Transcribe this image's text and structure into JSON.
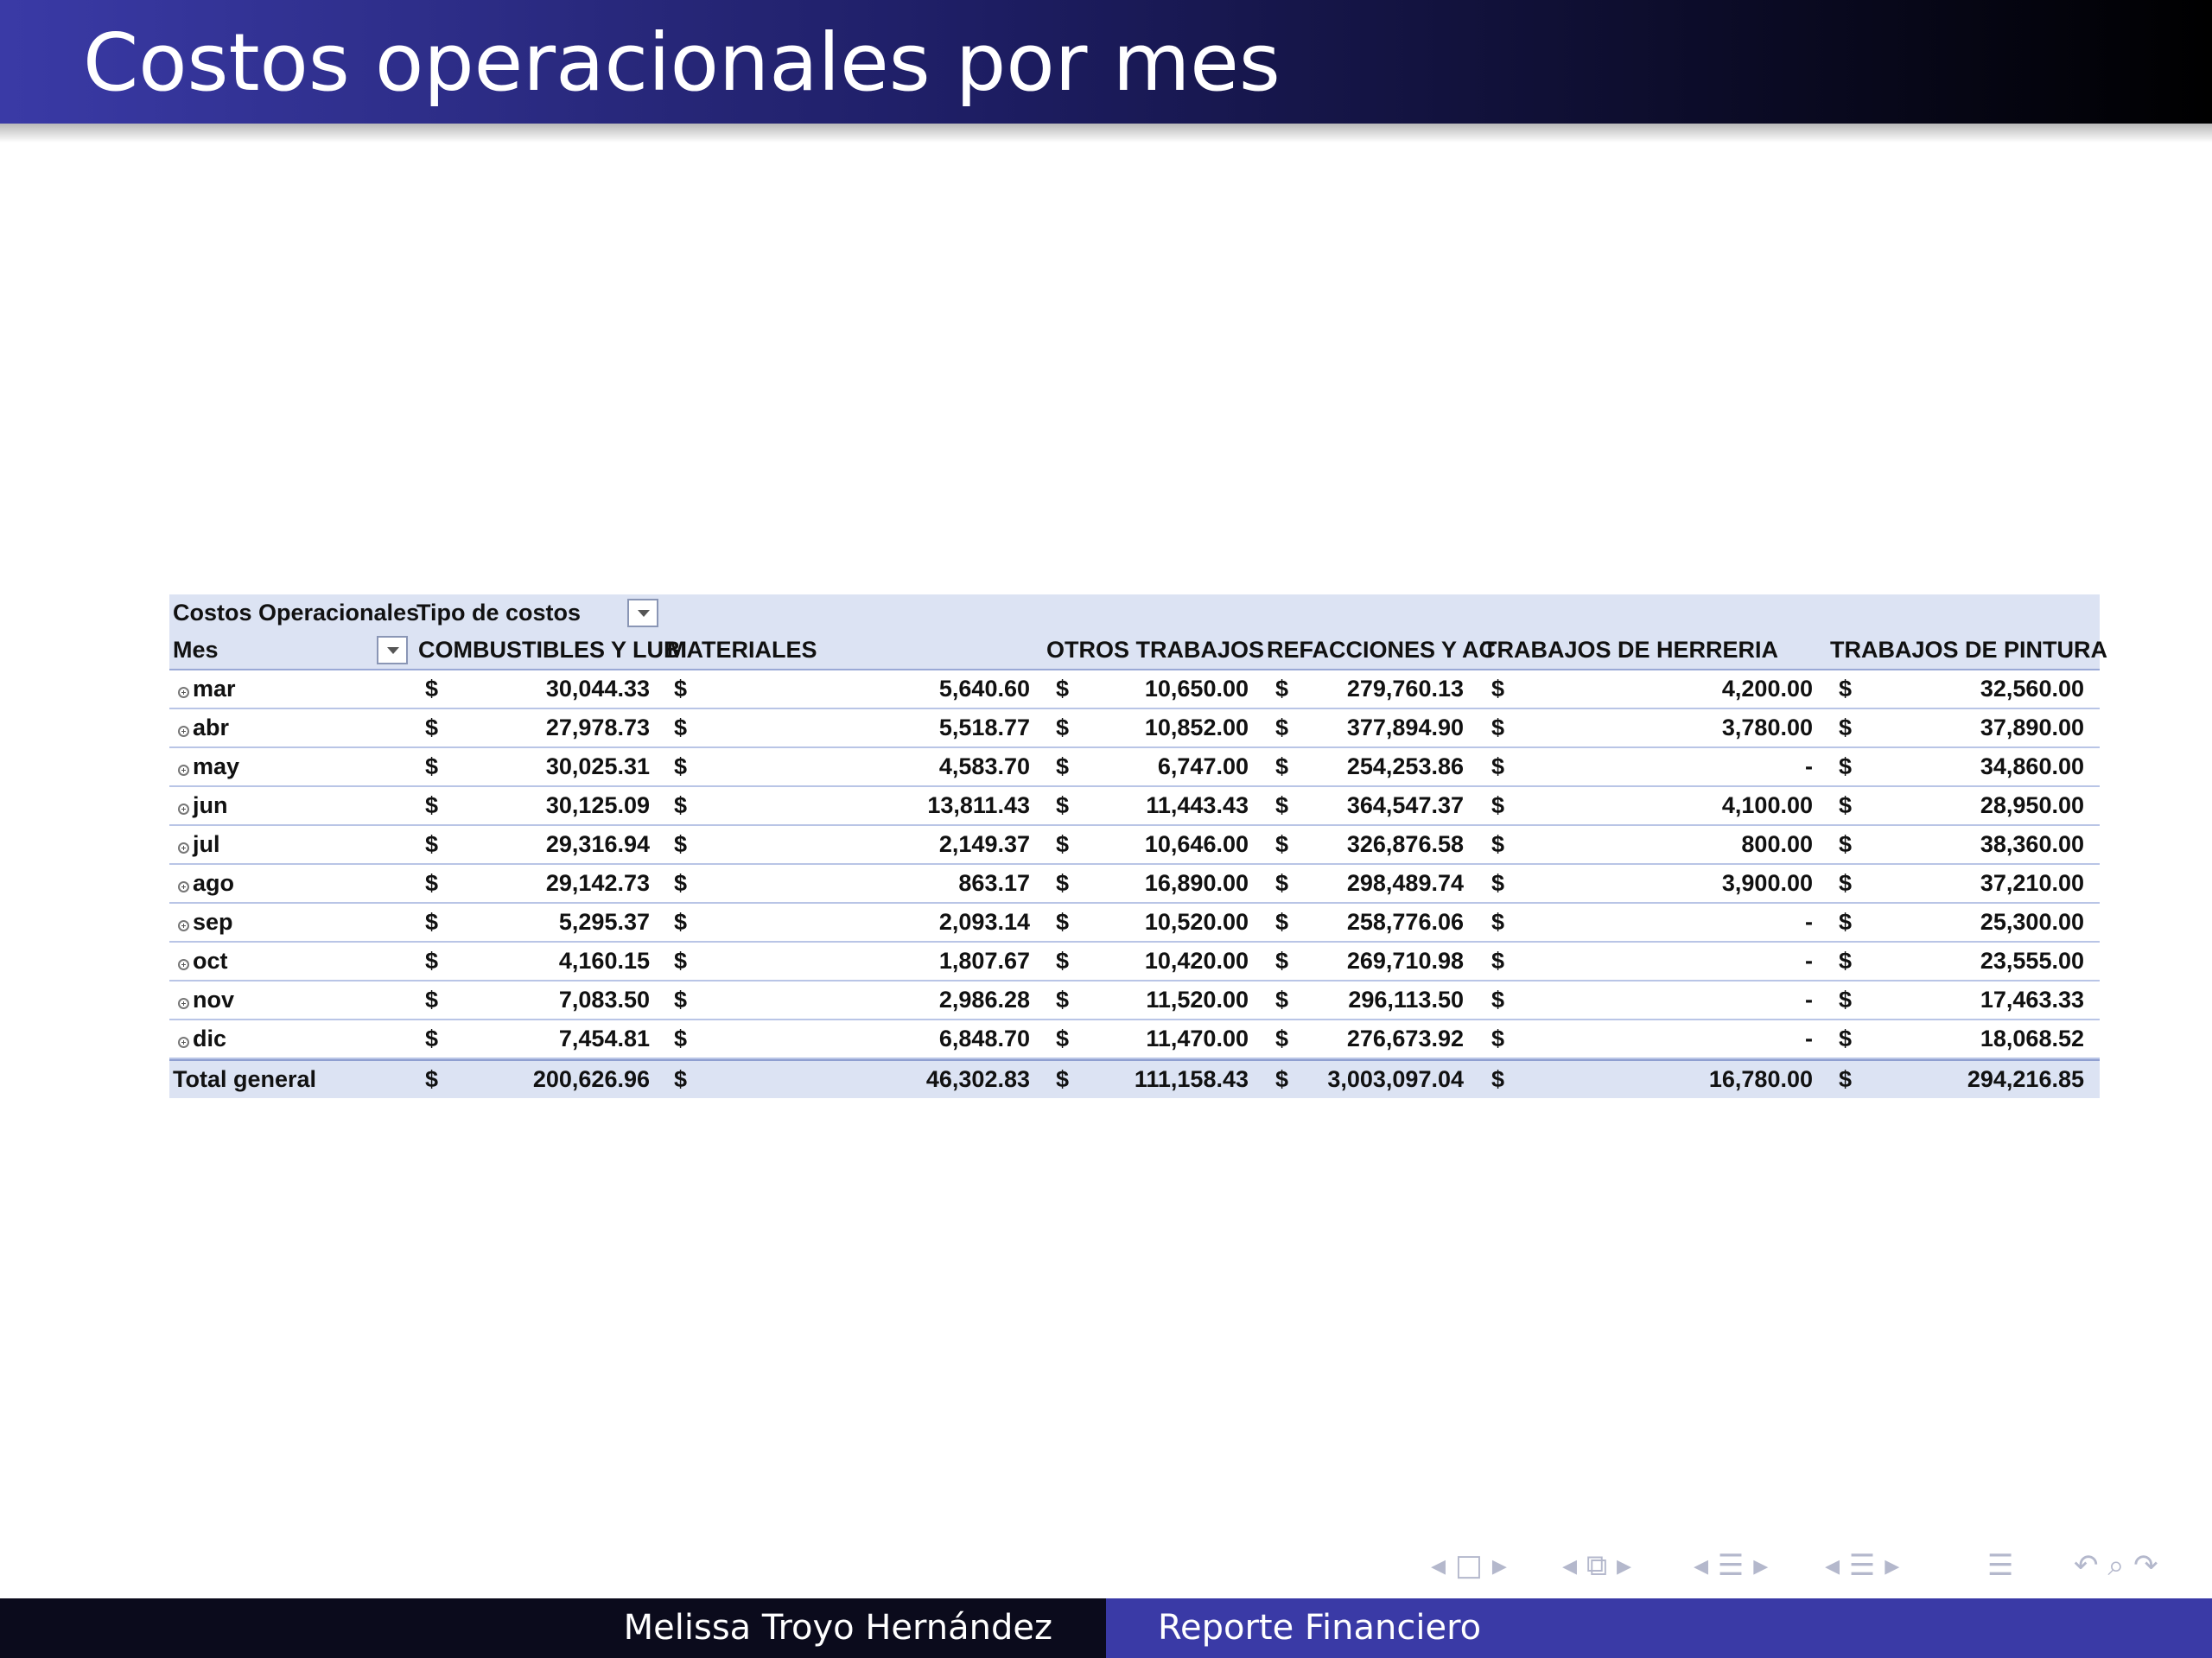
{
  "slide": {
    "title": "Costos operacionales por mes"
  },
  "pivot": {
    "row_label_header": "Costos Operacionales",
    "column_field": "Tipo de costos",
    "row_field": "Mes",
    "currency": "$",
    "columns": [
      "COMBUSTIBLES Y LUBI",
      "MATERIALES",
      "OTROS TRABAJOS",
      "REFACCIONES Y AC",
      "TRABAJOS DE HERRERIA",
      "TRABAJOS DE PINTURA"
    ],
    "rows": [
      {
        "mes": "mar",
        "values": [
          "30,044.33",
          "5,640.60",
          "10,650.00",
          "279,760.13",
          "4,200.00",
          "32,560.00"
        ]
      },
      {
        "mes": "abr",
        "values": [
          "27,978.73",
          "5,518.77",
          "10,852.00",
          "377,894.90",
          "3,780.00",
          "37,890.00"
        ]
      },
      {
        "mes": "may",
        "values": [
          "30,025.31",
          "4,583.70",
          "6,747.00",
          "254,253.86",
          "-",
          "34,860.00"
        ]
      },
      {
        "mes": "jun",
        "values": [
          "30,125.09",
          "13,811.43",
          "11,443.43",
          "364,547.37",
          "4,100.00",
          "28,950.00"
        ]
      },
      {
        "mes": "jul",
        "values": [
          "29,316.94",
          "2,149.37",
          "10,646.00",
          "326,876.58",
          "800.00",
          "38,360.00"
        ]
      },
      {
        "mes": "ago",
        "values": [
          "29,142.73",
          "863.17",
          "16,890.00",
          "298,489.74",
          "3,900.00",
          "37,210.00"
        ]
      },
      {
        "mes": "sep",
        "values": [
          "5,295.37",
          "2,093.14",
          "10,520.00",
          "258,776.06",
          "-",
          "25,300.00"
        ]
      },
      {
        "mes": "oct",
        "values": [
          "4,160.15",
          "1,807.67",
          "10,420.00",
          "269,710.98",
          "-",
          "23,555.00"
        ]
      },
      {
        "mes": "nov",
        "values": [
          "7,083.50",
          "2,986.28",
          "11,520.00",
          "296,113.50",
          "-",
          "17,463.33"
        ]
      },
      {
        "mes": "dic",
        "values": [
          "7,454.81",
          "6,848.70",
          "11,470.00",
          "276,673.92",
          "-",
          "18,068.52"
        ]
      }
    ],
    "total": {
      "label": "Total general",
      "values": [
        "200,626.96",
        "46,302.83",
        "111,158.43",
        "3,003,097.04",
        "16,780.00",
        "294,216.85"
      ]
    }
  },
  "navigation": {
    "slide_prev": "◂",
    "slide_icon": "□",
    "slide_next": "▸",
    "frame_prev": "◂",
    "frame_icon": "⧉",
    "frame_next": "▸",
    "subsection_prev": "◂",
    "subsection_icon": "☰",
    "subsection_next": "▸",
    "section_prev": "◂",
    "section_icon": "☰",
    "section_next": "▸",
    "toc_icon": "☰",
    "back_icon": "↶",
    "search_icon": "⌕",
    "forward_icon": "↷"
  },
  "footer": {
    "author": "Melissa Troyo Hernández",
    "title": "Reporte Financiero"
  }
}
